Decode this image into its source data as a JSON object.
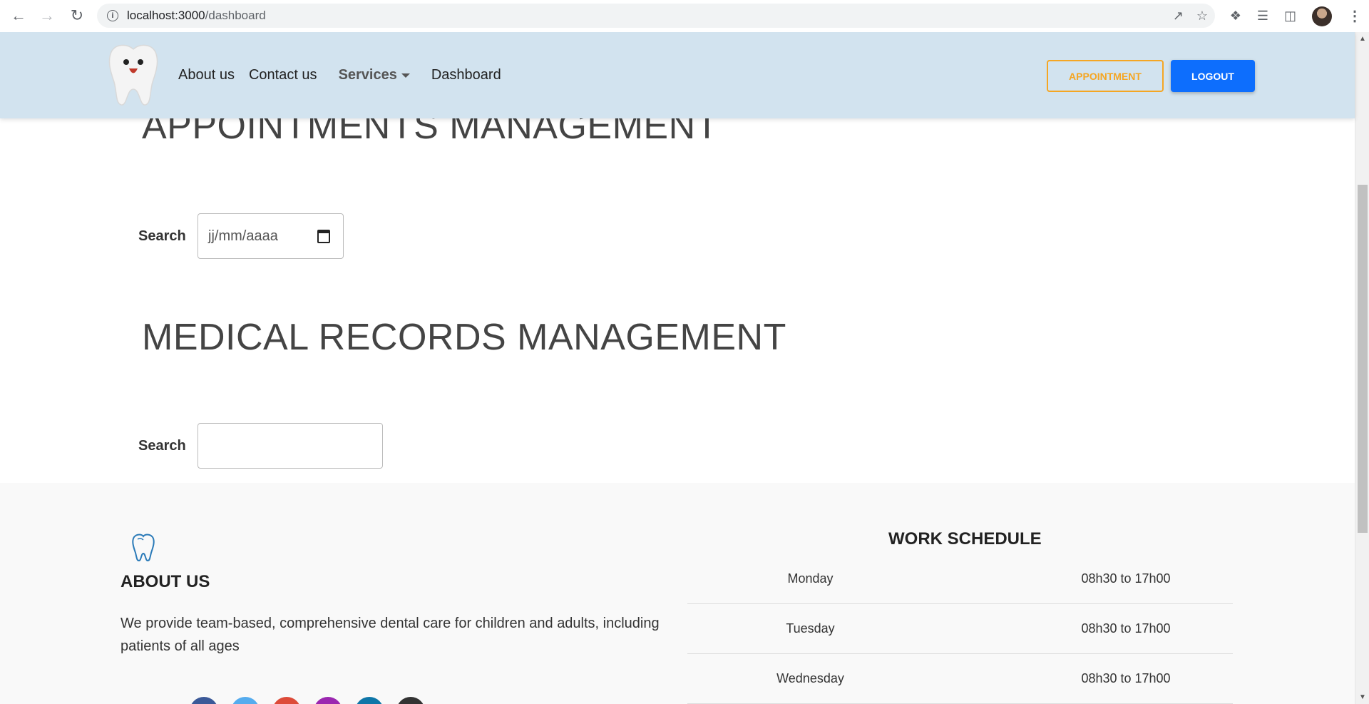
{
  "browser": {
    "url_host": "localhost:3000",
    "url_path": "/dashboard"
  },
  "header": {
    "nav": {
      "about": "About us",
      "contact": "Contact us",
      "services": "Services",
      "dashboard": "Dashboard"
    },
    "appointment_button": "APPOINTMENT",
    "logout_button": "LOGOUT"
  },
  "main": {
    "appointments_title": "APPOINTMENTS MANAGEMENT",
    "appointments_search_label": "Search",
    "appointments_date_placeholder": "jj/mm/aaaa",
    "medical_title": "MEDICAL RECORDS MANAGEMENT",
    "medical_search_label": "Search",
    "medical_search_value": ""
  },
  "footer": {
    "about_title": "ABOUT US",
    "about_text": "We provide team-based, comprehensive dental care for children and adults, including patients of all ages",
    "schedule_title": "WORK SCHEDULE",
    "schedule": [
      {
        "day": "Monday",
        "hours": "08h30 to 17h00"
      },
      {
        "day": "Tuesday",
        "hours": "08h30 to 17h00"
      },
      {
        "day": "Wednesday",
        "hours": "08h30 to 17h00"
      }
    ],
    "social_colors": [
      "#3b5998",
      "#55acee",
      "#dd4b39",
      "#9b27b0",
      "#0e76a8",
      "#333333"
    ]
  },
  "colors": {
    "header_bg": "#d2e3ef",
    "accent_orange": "#f5a623",
    "primary_blue": "#0d6efd",
    "footer_bg": "#f9f9f9"
  }
}
